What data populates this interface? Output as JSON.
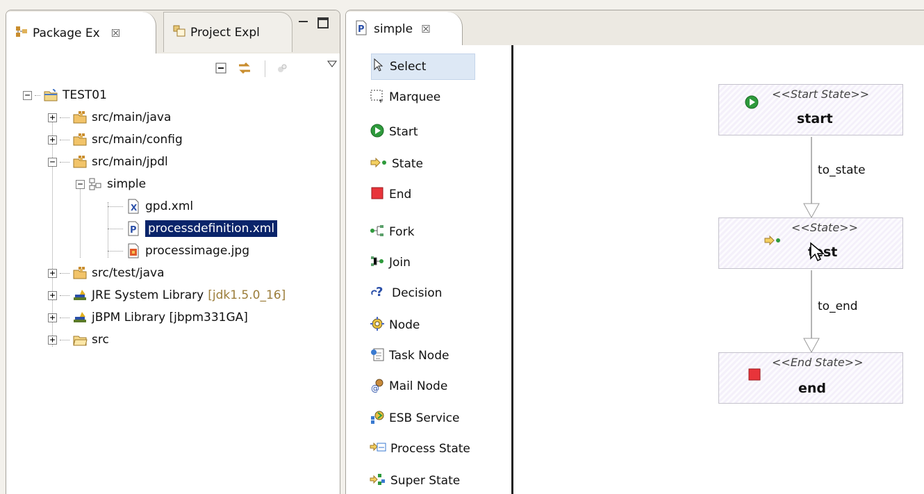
{
  "left_view": {
    "tabs": [
      {
        "label": "Package Ex",
        "close": "☒",
        "icon": "package-explorer-icon"
      },
      {
        "label": "Project Expl",
        "icon": "project-explorer-icon"
      }
    ],
    "toolbar_icons": [
      "collapse-all-icon",
      "link-with-editor-icon",
      "filter-icon",
      "view-menu-icon"
    ],
    "tree": [
      {
        "label": "TEST01",
        "expander": "−",
        "icon": "java-project-icon"
      },
      {
        "label": "src/main/java",
        "expander": "+",
        "icon": "source-folder-icon"
      },
      {
        "label": "src/main/config",
        "expander": "+",
        "icon": "source-folder-icon"
      },
      {
        "label": "src/main/jpdl",
        "expander": "−",
        "icon": "source-folder-icon"
      },
      {
        "label": "simple",
        "expander": "−",
        "icon": "process-folder-icon"
      },
      {
        "label": "gpd.xml",
        "icon": "xml-file-icon"
      },
      {
        "label": "processdefinition.xml",
        "icon": "process-file-icon",
        "selected": true
      },
      {
        "label": "processimage.jpg",
        "icon": "image-file-icon"
      },
      {
        "label": "src/test/java",
        "expander": "+",
        "icon": "source-folder-icon"
      },
      {
        "label": "JRE System Library",
        "suffix": "[jdk1.5.0_16]",
        "expander": "+",
        "icon": "library-icon"
      },
      {
        "label": "jBPM Library [jbpm331GA]",
        "expander": "+",
        "icon": "library-icon"
      },
      {
        "label": "src",
        "expander": "+",
        "icon": "folder-icon"
      }
    ]
  },
  "editor": {
    "tab": {
      "label": "simple",
      "close": "☒",
      "icon": "process-file-icon"
    },
    "palette": [
      {
        "label": "Select",
        "icon": "select-arrow-icon",
        "selected": true
      },
      {
        "label": "Marquee",
        "icon": "marquee-icon"
      },
      {
        "label": "Start",
        "icon": "start-icon"
      },
      {
        "label": "State",
        "icon": "state-icon"
      },
      {
        "label": "End",
        "icon": "end-icon"
      },
      {
        "label": "Fork",
        "icon": "fork-icon"
      },
      {
        "label": "Join",
        "icon": "join-icon"
      },
      {
        "label": "Decision",
        "icon": "decision-icon"
      },
      {
        "label": "Node",
        "icon": "node-icon"
      },
      {
        "label": "Task Node",
        "icon": "task-node-icon"
      },
      {
        "label": "Mail Node",
        "icon": "mail-node-icon"
      },
      {
        "label": "ESB Service",
        "icon": "esb-service-icon"
      },
      {
        "label": "Process State",
        "icon": "process-state-icon"
      },
      {
        "label": "Super State",
        "icon": "super-state-icon"
      }
    ],
    "diagram": {
      "nodes": [
        {
          "stereotype": "<<Start State>>",
          "name": "start",
          "icon": "start-icon"
        },
        {
          "stereotype": "<<State>>",
          "name": "test",
          "icon": "state-icon"
        },
        {
          "stereotype": "<<End State>>",
          "name": "end",
          "icon": "end-icon"
        }
      ],
      "transitions": [
        {
          "label": "to_state"
        },
        {
          "label": "to_end"
        }
      ]
    }
  }
}
